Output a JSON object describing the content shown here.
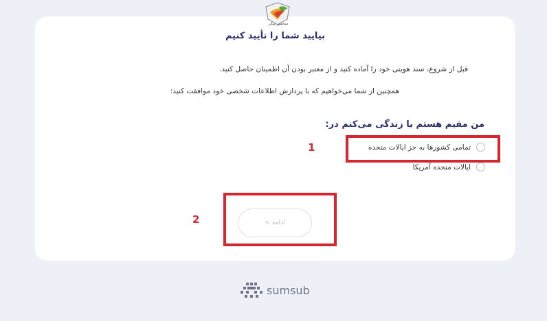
{
  "logo": {
    "caption": "سجس پیکر",
    "icon": "brand-logo-icon"
  },
  "verify": {
    "title": "بیایید شما را تأیید کنیم",
    "intro_line1": "قبل از شروع، سند هویتی خود را آماده کنید و از معتبر بودن آن اطمینان حاصل کنید.",
    "intro_line2": "همچنین از شما می‌خواهیم که با پردازش اطلاعات شخصی خود موافقت کنید:"
  },
  "residence": {
    "label": "من مقیم هستم یا زندگی می‌کنم در:",
    "options": [
      {
        "label": "تمامی کشورها به جز ایالات متحده",
        "selected": false
      },
      {
        "label": "ایالات متحده آمریکا",
        "selected": false
      }
    ]
  },
  "annotations": {
    "marker1": "1",
    "marker2": "2",
    "highlight_color": "#d6262f"
  },
  "continue_button": {
    "label": "ادامه >"
  },
  "footer": {
    "brand": "sumsub",
    "icon": "sumsub-logo-icon"
  },
  "colors": {
    "title": "#2a2f6e",
    "background": "#eef0f8",
    "card": "#ffffff"
  }
}
